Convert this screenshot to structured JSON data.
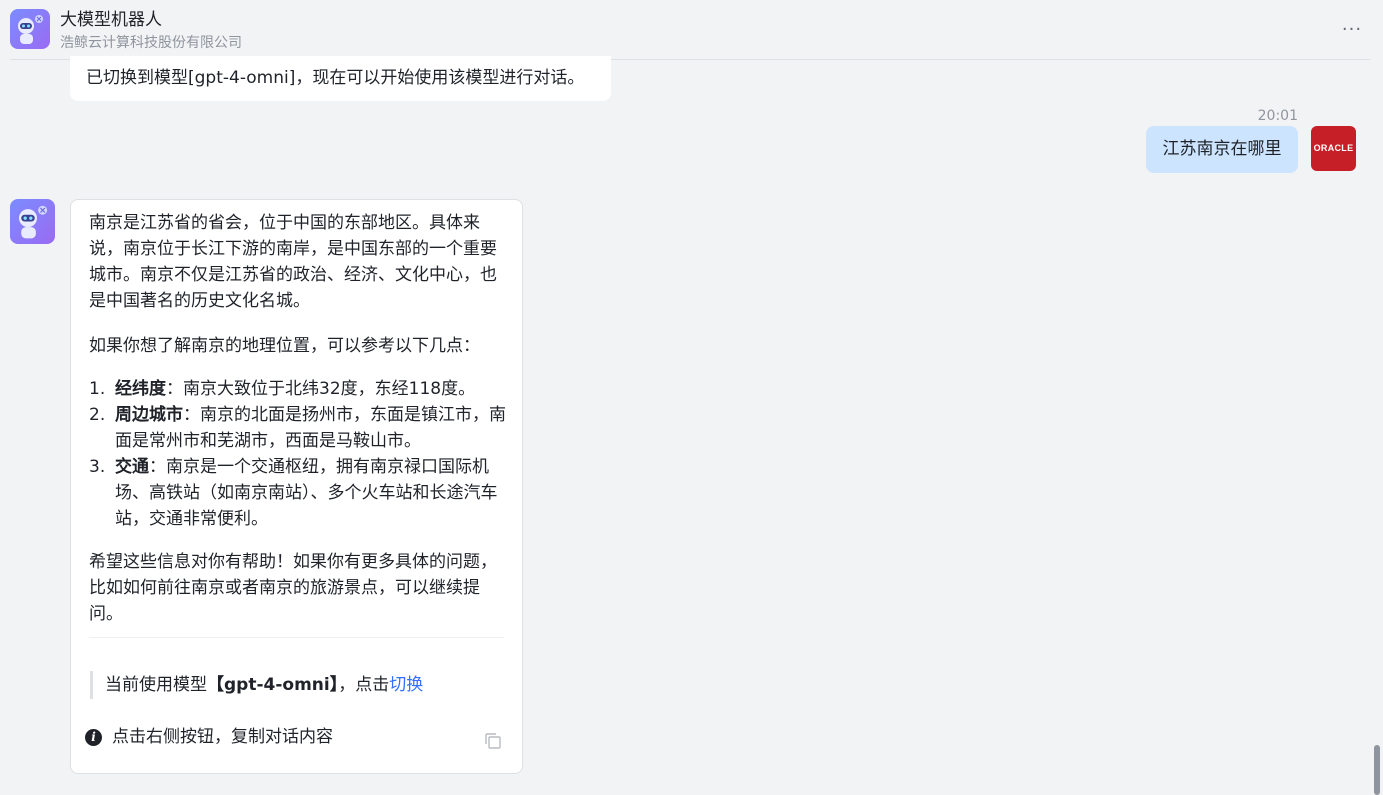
{
  "header": {
    "title": "大模型机器人",
    "subtitle": "浩鲸云计算科技股份有限公司",
    "more_icon": "more-icon"
  },
  "messages": {
    "previous": "已切换到模型[gpt-4-omni]，现在可以开始使用该模型进行对话。",
    "time": "20:01",
    "user_question": "江苏南京在哪里",
    "user_avatar_text": "ORACLE"
  },
  "answer": {
    "para1": "南京是江苏省的省会，位于中国的东部地区。具体来说，南京位于长江下游的南岸，是中国东部的一个重要城市。南京不仅是江苏省的政治、经济、文化中心，也是中国著名的历史文化名城。",
    "para2": "如果你想了解南京的地理位置，可以参考以下几点：",
    "list": [
      {
        "num": "1.",
        "label": "经纬度",
        "text": "：南京大致位于北纬32度，东经118度。"
      },
      {
        "num": "2.",
        "label": "周边城市",
        "text": "：南京的北面是扬州市，东面是镇江市，南面是常州市和芜湖市，西面是马鞍山市。"
      },
      {
        "num": "3.",
        "label": "交通",
        "text": "：南京是一个交通枢纽，拥有南京禄口国际机场、高铁站（如南京南站）、多个火车站和长途汽车站，交通非常便利。"
      }
    ],
    "para3": "希望这些信息对你有帮助！如果你有更多具体的问题，比如如何前往南京或者南京的旅游景点，可以继续提问。",
    "model_prefix": "当前使用模型",
    "model_name": "【gpt-4-omni】",
    "model_suffix": "，点击",
    "switch_link": "切换",
    "copy_hint": "点击右侧按钮，复制对话内容"
  },
  "colors": {
    "background": "#f2f3f5",
    "user_bubble": "#cce4fd",
    "link": "#3370ff",
    "oracle_red": "#c71f28"
  }
}
